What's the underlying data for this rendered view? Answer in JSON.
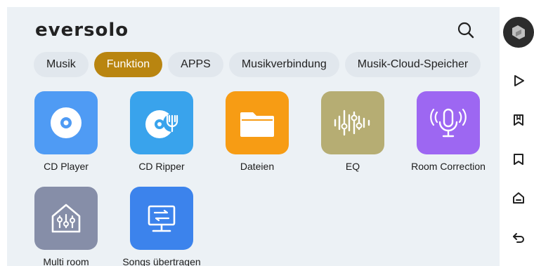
{
  "app": {
    "logo_text": "eversolo"
  },
  "header": {
    "search_icon": "search-icon"
  },
  "tabs": [
    {
      "label": "Musik",
      "active": false
    },
    {
      "label": "Funktion",
      "active": true
    },
    {
      "label": "APPS",
      "active": false
    },
    {
      "label": "Musikverbindung",
      "active": false
    },
    {
      "label": "Musik-Cloud-Speicher",
      "active": false
    }
  ],
  "tiles": [
    {
      "label": "CD Player",
      "icon": "disc-icon",
      "color": "#4f9bf4"
    },
    {
      "label": "CD Ripper",
      "icon": "disc-ripper-icon",
      "color": "#39a3ec"
    },
    {
      "label": "Dateien",
      "icon": "folder-icon",
      "color": "#f79c14"
    },
    {
      "label": "EQ",
      "icon": "equalizer-icon",
      "color": "#b6ad73"
    },
    {
      "label": "Room Correction",
      "icon": "microphone-icon",
      "color": "#9d67f2"
    },
    {
      "label": "Multi room",
      "icon": "multiroom-icon",
      "color": "#868ea8"
    },
    {
      "label": "Songs übertragen",
      "icon": "transfer-icon",
      "color": "#3c83ec"
    }
  ],
  "rail": {
    "items": [
      "avatar",
      "play-icon",
      "bookmark-icon",
      "bookmark-outline-icon",
      "home-icon",
      "back-icon"
    ]
  },
  "colors": {
    "active_tab": "#b98510",
    "background": "#ecf1f5"
  }
}
